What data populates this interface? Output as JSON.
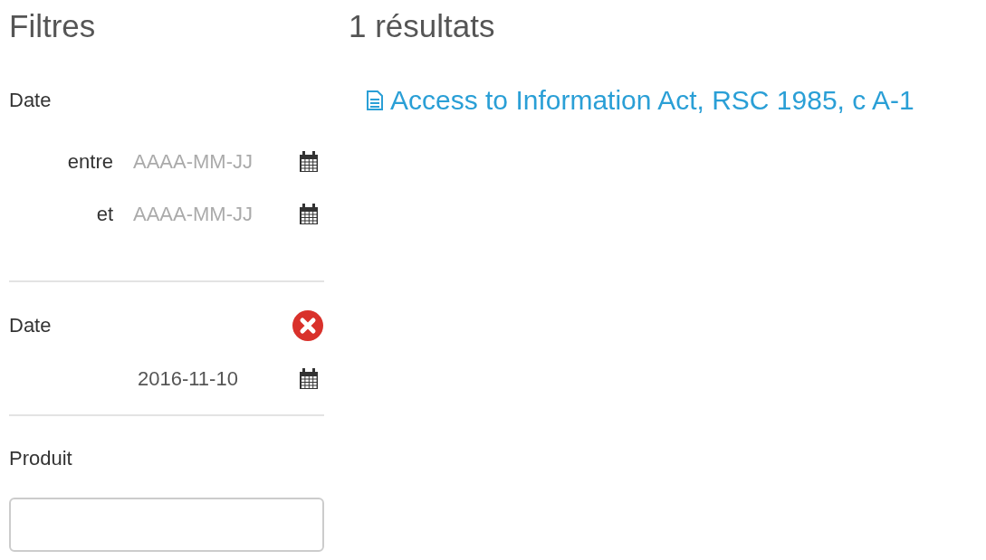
{
  "filters": {
    "title": "Filtres",
    "date_range": {
      "label": "Date",
      "fields": [
        {
          "label": "entre",
          "placeholder": "AAAA-MM-JJ"
        },
        {
          "label": "et",
          "placeholder": "AAAA-MM-JJ"
        }
      ]
    },
    "date_single": {
      "label": "Date",
      "value": "2016-11-10"
    },
    "product": {
      "label": "Produit"
    }
  },
  "results": {
    "title": "1 résultats",
    "items": [
      {
        "title": "Access to Information Act, RSC 1985, c A-1"
      }
    ]
  }
}
